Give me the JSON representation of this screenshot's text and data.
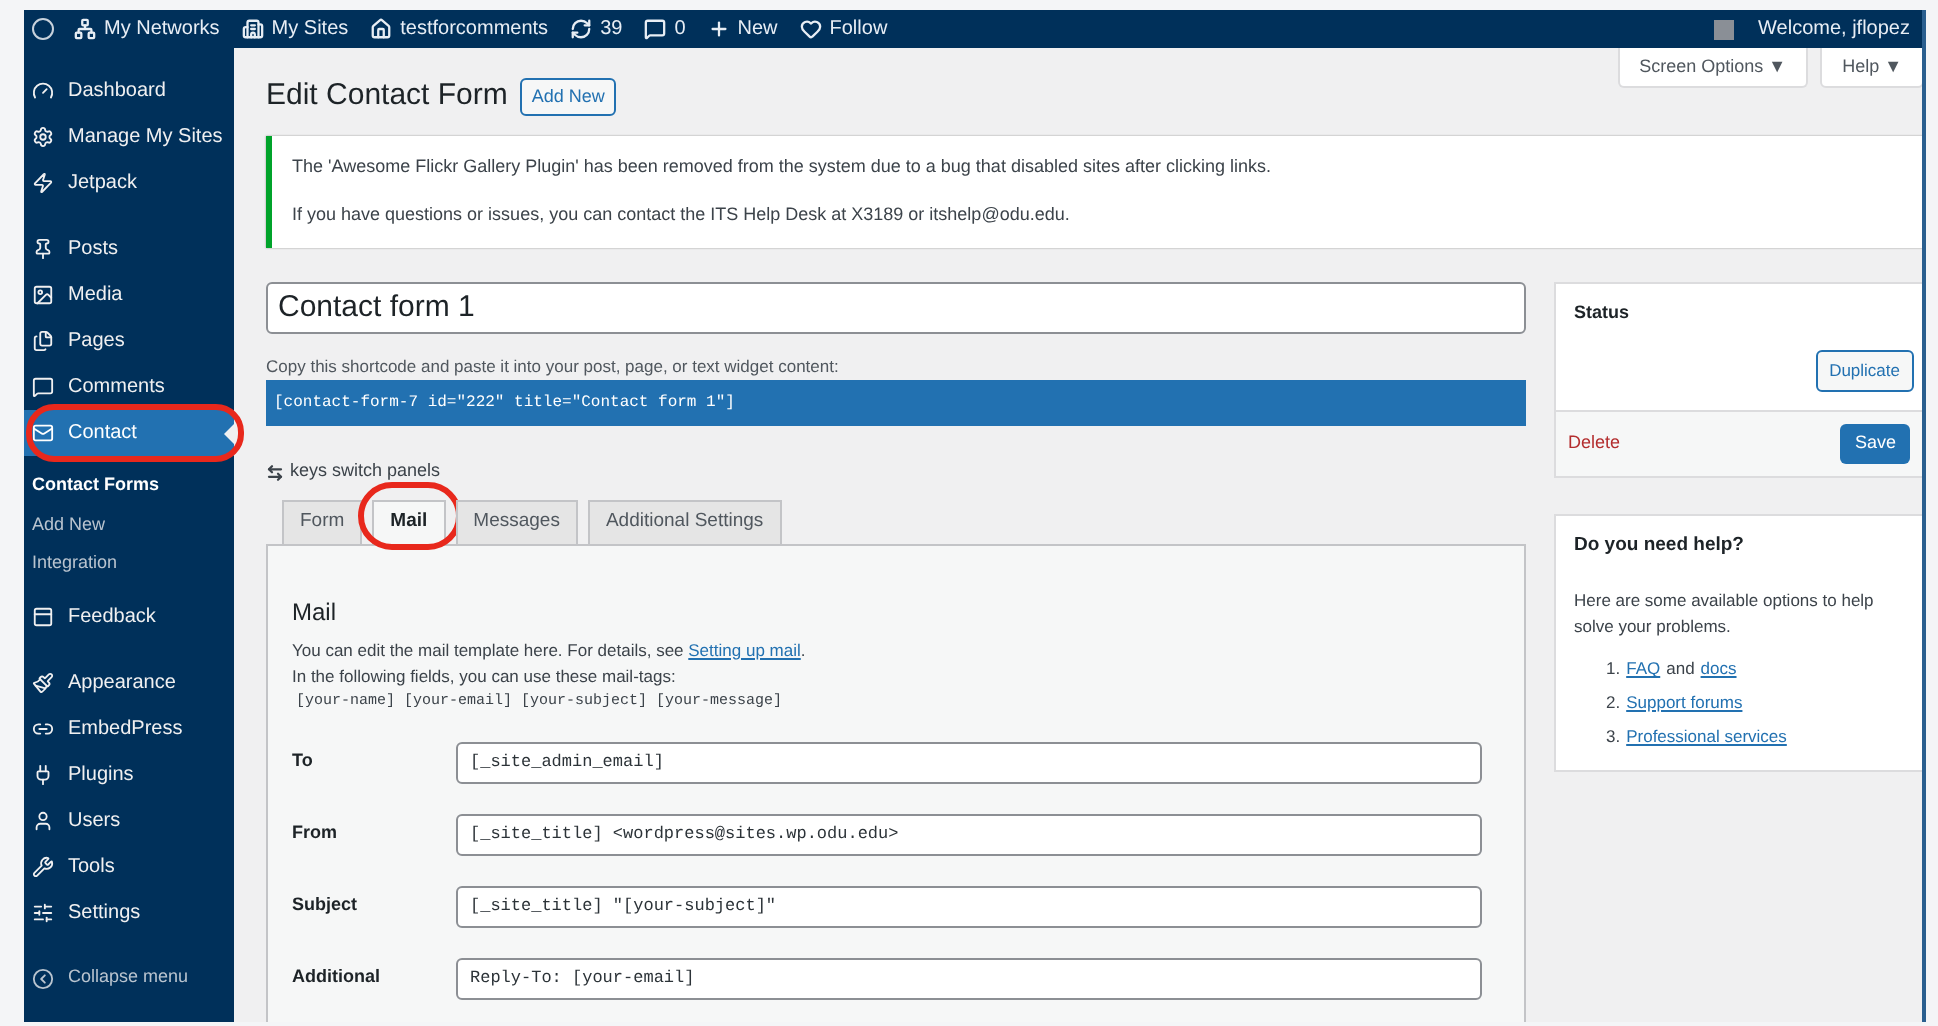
{
  "admin_bar": {
    "items": [
      {
        "label": "My Networks"
      },
      {
        "label": "My Sites"
      },
      {
        "label": "testforcomments"
      },
      {
        "label": "39"
      },
      {
        "label": "0"
      },
      {
        "label": "New"
      },
      {
        "label": "Follow"
      }
    ],
    "welcome": "Welcome, jflopez"
  },
  "sidebar": {
    "groups": [
      [
        {
          "label": "Dashboard",
          "selected": false,
          "annotated": false
        },
        {
          "label": "Manage My Sites",
          "selected": false,
          "annotated": false
        },
        {
          "label": "Jetpack",
          "selected": false,
          "annotated": false
        }
      ],
      [
        {
          "label": "Posts",
          "selected": false,
          "annotated": false
        },
        {
          "label": "Media",
          "selected": false,
          "annotated": false
        },
        {
          "label": "Pages",
          "selected": false,
          "annotated": false
        },
        {
          "label": "Comments",
          "selected": false,
          "annotated": false
        },
        {
          "label": "Contact",
          "selected": true,
          "annotated": true,
          "children": [
            {
              "label": "Contact Forms",
              "selected": true
            },
            {
              "label": "Add New",
              "selected": false
            },
            {
              "label": "Integration",
              "selected": false
            }
          ]
        },
        {
          "label": "Feedback",
          "selected": false,
          "annotated": false
        }
      ],
      [
        {
          "label": "Appearance",
          "selected": false,
          "annotated": false
        },
        {
          "label": "EmbedPress",
          "selected": false,
          "annotated": false
        },
        {
          "label": "Plugins",
          "selected": false,
          "annotated": false
        },
        {
          "label": "Users",
          "selected": false,
          "annotated": false
        },
        {
          "label": "Tools",
          "selected": false,
          "annotated": false
        },
        {
          "label": "Settings",
          "selected": false,
          "annotated": false
        }
      ]
    ],
    "collapse": "Collapse menu"
  },
  "screen_options": "Screen Options ▼",
  "help": "Help ▼",
  "page_title": "Edit Contact Form",
  "add_new": "Add New",
  "notice": [
    "The 'Awesome Flickr Gallery Plugin' has been removed from the system due to a bug that disabled sites after clicking links.",
    "If you have questions or issues, you can contact the ITS Help Desk at X3189 or itshelp@odu.edu."
  ],
  "form_title": "Contact form 1",
  "shortcode_label": "Copy this shortcode and paste it into your post, page, or text widget content:",
  "shortcode": "[contact-form-7 id=\"222\" title=\"Contact form 1\"]",
  "keys_hint": "keys switch panels",
  "tabs": [
    {
      "label": "Form",
      "selected": false,
      "annotated": false
    },
    {
      "label": "Mail",
      "selected": true,
      "annotated": true
    },
    {
      "label": "Messages",
      "selected": false,
      "annotated": false
    },
    {
      "label": "Additional Settings",
      "selected": false,
      "annotated": false
    }
  ],
  "mail": {
    "heading": "Mail",
    "intro": "You can edit the mail template here. For details, see ",
    "intro_link": "Setting up mail",
    "intro_end": ".",
    "tags_intro": "In the following fields, you can use these mail-tags:",
    "tags": "[your-name] [your-email] [your-subject] [your-message]",
    "fields": [
      {
        "label": "To",
        "value": "[_site_admin_email]"
      },
      {
        "label": "From",
        "value": "[_site_title] <wordpress@sites.wp.odu.edu>"
      },
      {
        "label": "Subject",
        "value": "[_site_title] \"[your-subject]\""
      },
      {
        "label": "Additional",
        "value": "Reply-To: [your-email]"
      }
    ]
  },
  "status": {
    "title": "Status",
    "duplicate": "Duplicate",
    "delete": "Delete",
    "save": "Save"
  },
  "help_box": {
    "title": "Do you need help?",
    "text": "Here are some available options to help solve your problems.",
    "items": [
      {
        "number": "1.",
        "links": [
          "FAQ",
          "docs"
        ],
        "joiner": " and "
      },
      {
        "number": "2.",
        "links": [
          "Support forums"
        ]
      },
      {
        "number": "3.",
        "links": [
          "Professional services"
        ]
      }
    ]
  }
}
